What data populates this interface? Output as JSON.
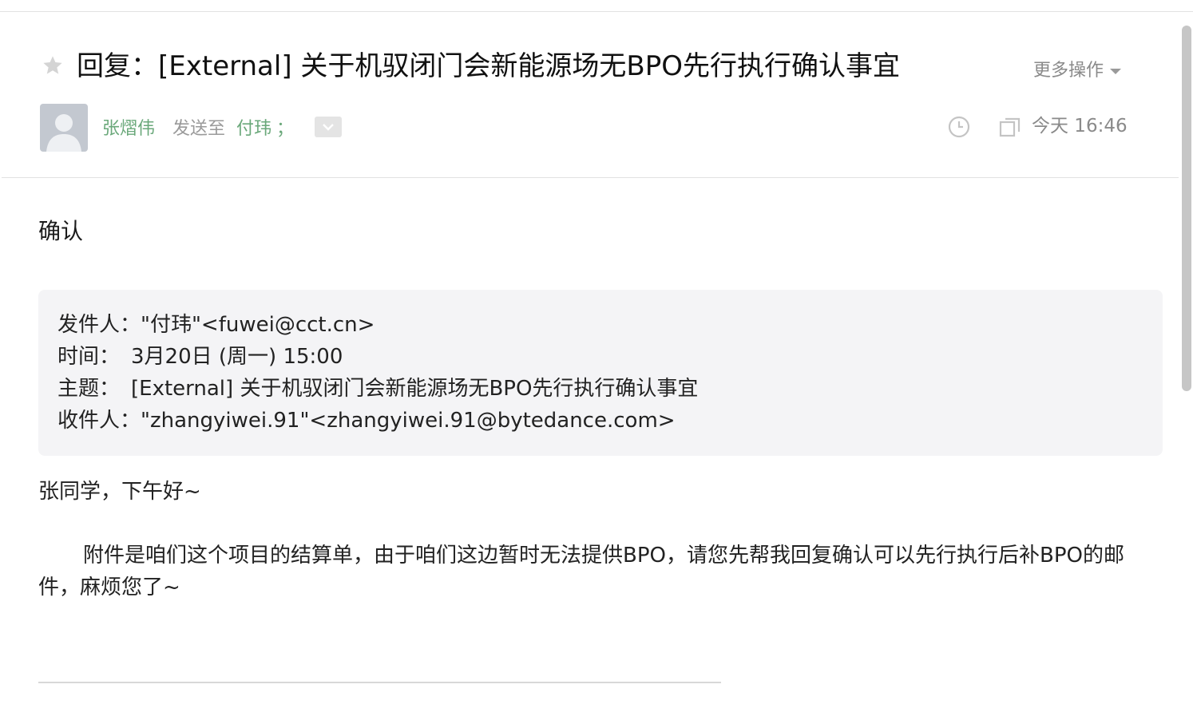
{
  "email": {
    "subject": "回复：[External] 关于机驭闭门会新能源场无BPO先行执行确认事宜",
    "more_actions_label": "更多操作",
    "sender_name": "张熠伟",
    "sent_to_label": "发送至",
    "recipient": "付玮",
    "recipient_separator": "；",
    "sent_time": "今天 16:46",
    "reply_body": "确认"
  },
  "quoted": {
    "from_label": "发件人：",
    "from_value": "\"付玮\"<fuwei@cct.cn>",
    "time_label": "时间：",
    "time_value": "3月20日 (周一) 15:00",
    "subject_label": "主题：",
    "subject_value": "[External] 关于机驭闭门会新能源场无BPO先行执行确认事宜",
    "to_label": "收件人：",
    "to_value": "\"zhangyiwei.91\"<zhangyiwei.91@bytedance.com>"
  },
  "message": {
    "greeting": "张同学，下午好~",
    "paragraph": "附件是咱们这个项目的结算单，由于咱们这边暂时无法提供BPO，请您先帮我回复确认可以先行执行后补BPO的邮件，麻烦您了~"
  },
  "icons": {
    "star": "star-icon",
    "avatar": "default-avatar",
    "expand": "chevron-down-icon",
    "clock": "clock-icon",
    "window": "new-window-icon",
    "more_caret": "caret-down-icon"
  },
  "colors": {
    "link_green": "#6aa87a",
    "muted_gray": "#8a8a8a",
    "quote_bg": "#f4f4f6"
  }
}
